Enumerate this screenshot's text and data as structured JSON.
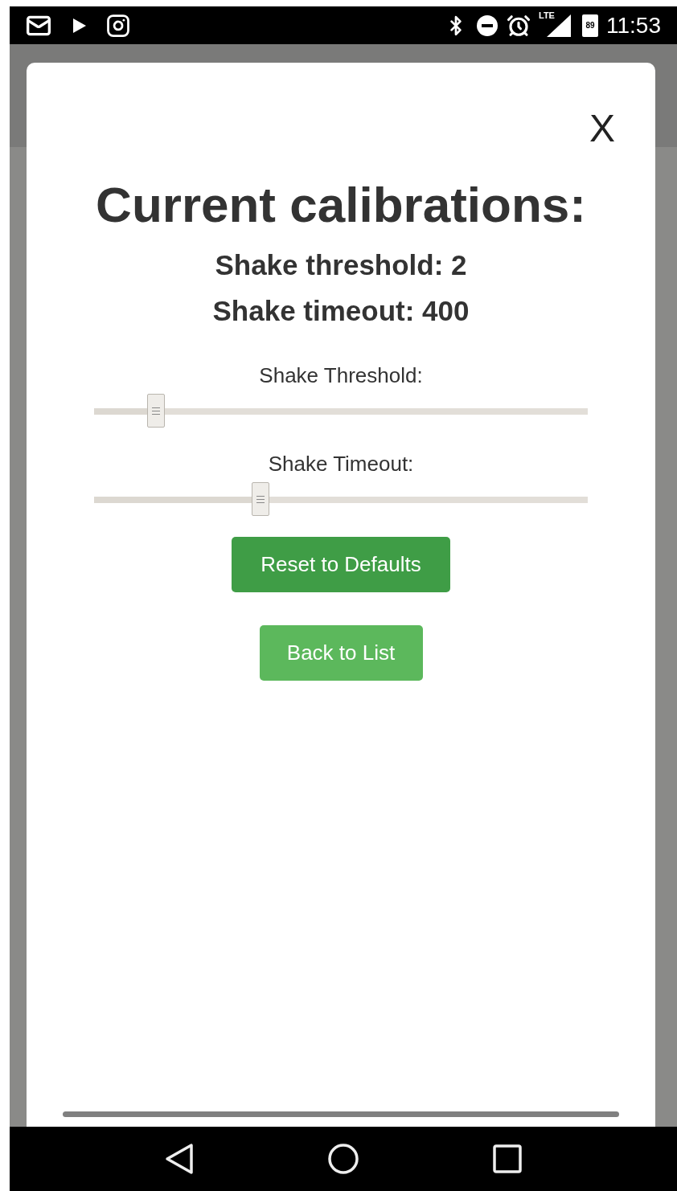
{
  "status_bar": {
    "network": "LTE",
    "battery": "89",
    "time": "11:53"
  },
  "dialog": {
    "close": "X",
    "title": "Current calibrations:",
    "readings": [
      "Shake threshold: 2",
      "Shake timeout: 400"
    ],
    "sliders": [
      {
        "label": "Shake Threshold:",
        "level": 0.125
      },
      {
        "label": "Shake Timeout:",
        "level": 0.337
      }
    ],
    "buttons": [
      {
        "label": "Reset to Defaults",
        "kind": "primary"
      },
      {
        "label": "Back to List",
        "kind": "secondary"
      }
    ]
  }
}
